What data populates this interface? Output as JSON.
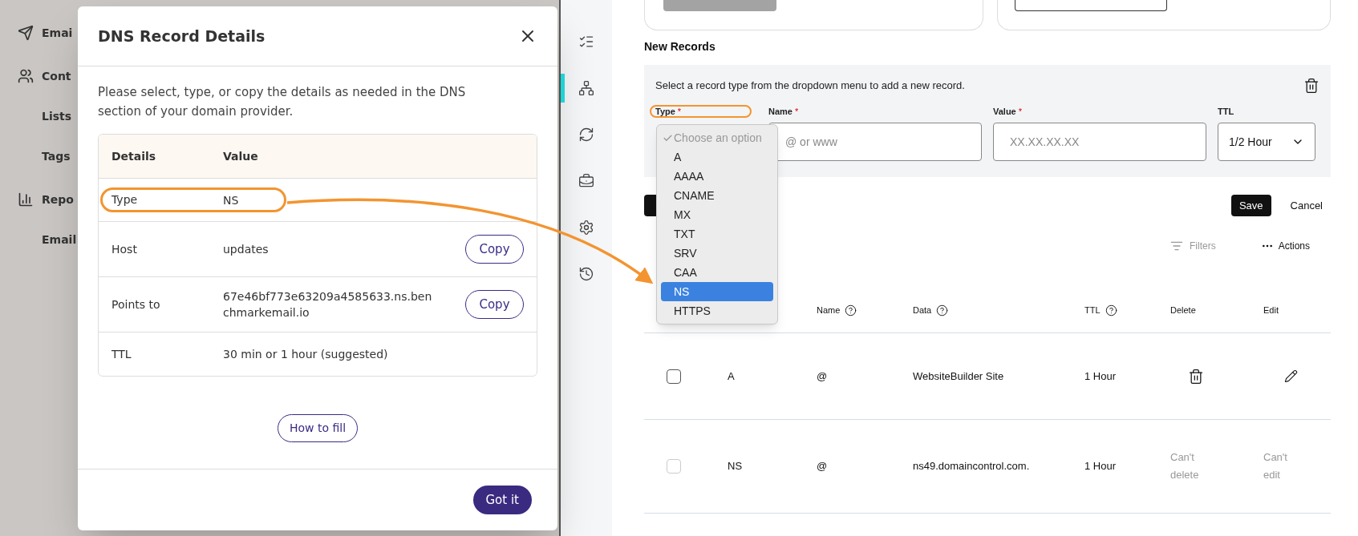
{
  "background_app": {
    "sidebar": [
      {
        "label": "Emai",
        "kind": "send"
      },
      {
        "label": "Cont",
        "kind": "contacts"
      },
      {
        "label": "Lists",
        "kind": "subitem"
      },
      {
        "label": "Tags",
        "kind": "subitem"
      },
      {
        "label": "Repo",
        "kind": "reports"
      },
      {
        "label": "Email",
        "kind": "subitem"
      }
    ]
  },
  "dialog": {
    "title": "DNS Record Details",
    "intro": "Please select, type, or copy the details as needed in the DNS section of your domain provider.",
    "columns": [
      "Details",
      "Value"
    ],
    "rows": [
      {
        "label": "Type",
        "value": "NS",
        "highlighted": true
      },
      {
        "label": "Host",
        "value": "updates",
        "copy": "Copy",
        "highlighted": false
      },
      {
        "label": "Points to",
        "value": "67e46bf773e63209a4585633.ns.benchmarkemail.io",
        "copy": "Copy",
        "highlighted": false
      },
      {
        "label": "TTL",
        "value": "30 min or 1 hour (suggested)",
        "highlighted": false
      }
    ],
    "help_button": "How to fill",
    "confirm_button": "Got it"
  },
  "icon_rail": [
    {
      "kind": "list",
      "selected": false
    },
    {
      "kind": "sitemap",
      "selected": true
    },
    {
      "kind": "transfer",
      "selected": false
    },
    {
      "kind": "briefcase",
      "selected": false
    },
    {
      "kind": "gear",
      "selected": false
    },
    {
      "kind": "history",
      "selected": false
    }
  ],
  "dns": {
    "section_title": "New Records",
    "instruction": "Select a record type from the dropdown menu to add a new record.",
    "fields": [
      {
        "label": "Type",
        "required_mark": "*",
        "highlighted": true,
        "kind": "hidden"
      },
      {
        "label": "Name",
        "required_mark": "*",
        "highlighted": false,
        "kind": "text",
        "placeholder": "@ or www"
      },
      {
        "label": "Value",
        "required_mark": "*",
        "highlighted": false,
        "kind": "text",
        "placeholder": "XX.XX.XX.XX"
      },
      {
        "label": "TTL",
        "highlighted": false,
        "kind": "select",
        "value": "1/2 Hour"
      }
    ],
    "dropdown": [
      {
        "label": "Choose an option",
        "kind": "placeholder",
        "checked": true,
        "selected": false
      },
      {
        "label": "A",
        "kind": "option",
        "checked": false,
        "selected": false
      },
      {
        "label": "AAAA",
        "kind": "option",
        "checked": false,
        "selected": false
      },
      {
        "label": "CNAME",
        "kind": "option",
        "checked": false,
        "selected": false
      },
      {
        "label": "MX",
        "kind": "option",
        "checked": false,
        "selected": false
      },
      {
        "label": "TXT",
        "kind": "option",
        "checked": false,
        "selected": false
      },
      {
        "label": "SRV",
        "kind": "option",
        "checked": false,
        "selected": false
      },
      {
        "label": "CAA",
        "kind": "option",
        "checked": false,
        "selected": false
      },
      {
        "label": "NS",
        "kind": "option",
        "checked": false,
        "selected": true
      },
      {
        "label": "HTTPS",
        "kind": "option",
        "checked": false,
        "selected": false
      }
    ],
    "save_button": "Save",
    "cancel_button": "Cancel",
    "filters": "Filters",
    "actions": "Actions",
    "columns": [
      "Name",
      "Data",
      "TTL",
      "Delete",
      "Edit"
    ],
    "records": [
      {
        "type": "A",
        "name": "@",
        "data": "WebsiteBuilder Site",
        "ttl": "1 Hour",
        "kind": "editable",
        "checked": false,
        "disabled": false
      },
      {
        "type": "NS",
        "name": "@",
        "data": "ns49.domaincontrol.com.",
        "ttl": "1 Hour",
        "kind": "locked",
        "checked": false,
        "disabled": true,
        "delete_note": "Can't delete",
        "edit_note": "Can't edit"
      }
    ]
  }
}
